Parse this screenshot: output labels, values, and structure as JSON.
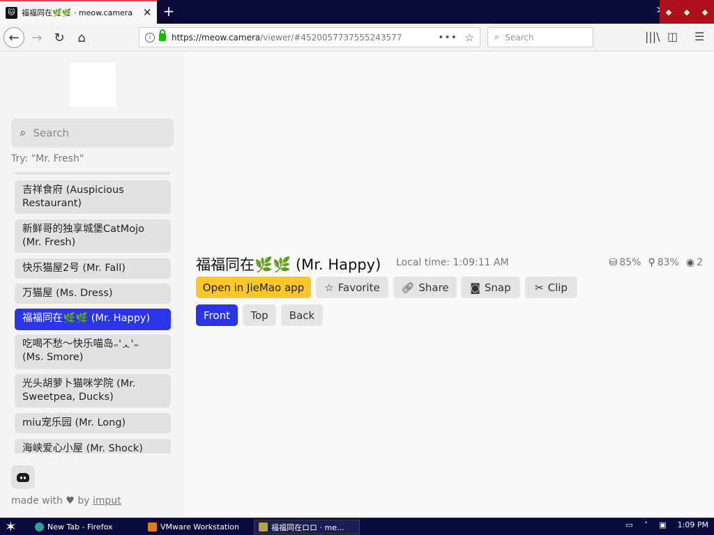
{
  "browser": {
    "tab_title": "福福同在🌿🌿 · meow.camera",
    "tab_favicon": "cat-face-icon",
    "url_domain": "https://meow.camera",
    "url_path": "/viewer/#4520057737555243577",
    "search_placeholder": "Search"
  },
  "sidebar": {
    "search_placeholder": "Search",
    "try_hint": "Try: \"Mr. Fresh\"",
    "cameras": [
      {
        "label": "吉祥食府 (Auspicious Restaurant)",
        "active": false
      },
      {
        "label": "新鲜哥的独享城堡CatMojo (Mr. Fresh)",
        "active": false
      },
      {
        "label": "快乐猫屋2号 (Mr. Fall)",
        "active": false
      },
      {
        "label": "万猫屋 (Ms. Dress)",
        "active": false
      },
      {
        "label": "福福同在🌿🌿 (Mr. Happy)",
        "active": true
      },
      {
        "label": "吃喝不愁～快乐喵岛₌'ᆺ'₌ (Ms. Smore)",
        "active": false
      },
      {
        "label": "光头胡萝卜猫咪学院 (Mr. Sweetpea, Ducks)",
        "active": false
      },
      {
        "label": "miu宠乐园 (Mr. Long)",
        "active": false
      },
      {
        "label": "海峡爱心小屋 (Mr. Shock)",
        "active": false
      }
    ],
    "footer_prefix": "made with",
    "footer_by": "by",
    "footer_link": "imput"
  },
  "viewer": {
    "camera_name": "福福同在🌿🌿 (Mr. Happy)",
    "local_time": "Local time: 1:09:11 AM",
    "food_level": "85%",
    "battery_level": "83%",
    "viewers": "2",
    "actions": {
      "open_app": "Open in JieMao app",
      "favorite": "Favorite",
      "share": "Share",
      "snap": "Snap",
      "clip": "Clip"
    },
    "views": {
      "front": "Front",
      "top": "Top",
      "back": "Back"
    },
    "active_view": "Front"
  },
  "taskbar": {
    "tasks": [
      "New Tab - Firefox",
      "VMware Workstation",
      "福福同在ロロ · me..."
    ],
    "clock": "1:09 PM"
  },
  "colors": {
    "accent_blue": "#2a34e8",
    "open_app_yellow": "#fcc62c",
    "tabbar_bg": "#0c0c3a"
  }
}
